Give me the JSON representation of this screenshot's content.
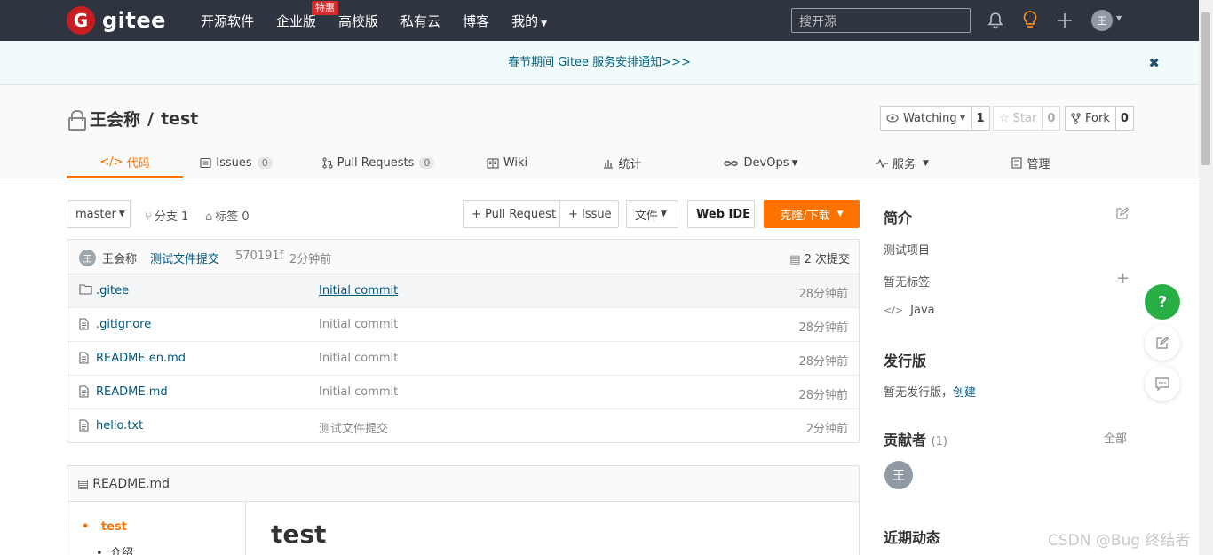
{
  "topnav": {
    "logo_mark": "G",
    "logo_text": "gitee",
    "items": [
      "开源软件",
      "企业版",
      "高校版",
      "私有云",
      "博客",
      "我的"
    ],
    "enterprise_badge": "特惠",
    "search_placeholder": "搜开源",
    "avatar": "王"
  },
  "notice": {
    "text": "春节期间 Gitee 服务安排通知>>>",
    "close": "✖"
  },
  "repo": {
    "owner": "王会称",
    "separator": "/",
    "name": "test",
    "watching": {
      "label": "Watching",
      "count": "1"
    },
    "star": {
      "label": "Star",
      "count": "0"
    },
    "fork": {
      "label": "Fork",
      "count": "0"
    }
  },
  "tabs": [
    {
      "label": "代码",
      "icon": "code-icon"
    },
    {
      "label": "Issues",
      "count": "0",
      "icon": "issues-icon"
    },
    {
      "label": "Pull Requests",
      "count": "0",
      "icon": "pull-request-icon"
    },
    {
      "label": "Wiki",
      "icon": "wiki-icon"
    },
    {
      "label": "统计",
      "icon": "stats-icon"
    },
    {
      "label": "DevOps",
      "icon": "devops-icon"
    },
    {
      "label": "服务",
      "icon": "service-icon"
    },
    {
      "label": "管理",
      "icon": "manage-icon"
    }
  ],
  "toolbar": {
    "branch": "master",
    "branches": "分支 1",
    "tags": "标签 0",
    "pull_request": "+ Pull Request",
    "issue": "+ Issue",
    "file": "文件",
    "web_ide": "Web IDE",
    "clone": "克隆/下载"
  },
  "commit": {
    "avatar": "王",
    "author": "王会称",
    "message": "测试文件提交",
    "hash": "570191f",
    "time": "2分钟前",
    "count": "2 次提交"
  },
  "files": [
    {
      "name": ".gitee",
      "type": "folder",
      "message": "Initial commit",
      "time": "28分钟前"
    },
    {
      "name": ".gitignore",
      "type": "file",
      "message": "Initial commit",
      "time": "28分钟前"
    },
    {
      "name": "README.en.md",
      "type": "file",
      "message": "Initial commit",
      "time": "28分钟前"
    },
    {
      "name": "README.md",
      "type": "file",
      "message": "Initial commit",
      "time": "28分钟前"
    },
    {
      "name": "hello.txt",
      "type": "file",
      "message": "测试文件提交",
      "time": "2分钟前"
    }
  ],
  "readme": {
    "filename": "README.md",
    "toc": [
      "test",
      "介绍"
    ],
    "heading": "test"
  },
  "sidebar": {
    "intro_title": "简介",
    "description": "测试项目",
    "no_tags": "暂无标签",
    "language": "Java",
    "releases_title": "发行版",
    "no_release": "暂无发行版，",
    "create": "创建",
    "contributors_title": "贡献者",
    "contributors_count": "(1)",
    "all": "全部",
    "contributor_avatar": "王",
    "activity_title": "近期动态"
  },
  "floating": {
    "help": "?"
  },
  "watermark": "CSDN @Bug 终结者"
}
